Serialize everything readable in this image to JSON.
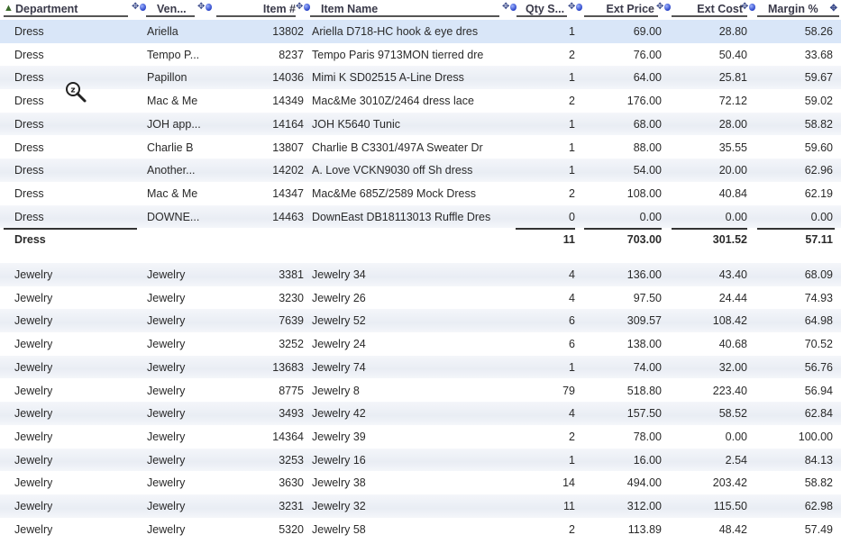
{
  "columns": {
    "department": "Department",
    "vendor": "Ven...",
    "item_no": "Item #",
    "item_name": "Item Name",
    "qty": "Qty S...",
    "ext_price": "Ext Price",
    "ext_cost": "Ext Cost",
    "margin": "Margin %"
  },
  "dress_rows": [
    {
      "dept": "Dress",
      "vendor": "Ariella",
      "item": "13802",
      "name": "Ariella D718-HC hook & eye dres",
      "qty": "1",
      "price": "69.00",
      "cost": "28.80",
      "margin": "58.26"
    },
    {
      "dept": "Dress",
      "vendor": "Tempo P...",
      "item": "8237",
      "name": "Tempo Paris 9713MON tierred dre",
      "qty": "2",
      "price": "76.00",
      "cost": "50.40",
      "margin": "33.68"
    },
    {
      "dept": "Dress",
      "vendor": "Papillon",
      "item": "14036",
      "name": "Mimi K SD02515 A-Line Dress",
      "qty": "1",
      "price": "64.00",
      "cost": "25.81",
      "margin": "59.67"
    },
    {
      "dept": "Dress",
      "vendor": "Mac & Me",
      "item": "14349",
      "name": "Mac&Me 3010Z/2464 dress lace",
      "qty": "2",
      "price": "176.00",
      "cost": "72.12",
      "margin": "59.02"
    },
    {
      "dept": "Dress",
      "vendor": "JOH app...",
      "item": "14164",
      "name": "JOH K5640 Tunic",
      "qty": "1",
      "price": "68.00",
      "cost": "28.00",
      "margin": "58.82"
    },
    {
      "dept": "Dress",
      "vendor": "Charlie B",
      "item": "13807",
      "name": "Charlie B C3301/497A Sweater Dr",
      "qty": "1",
      "price": "88.00",
      "cost": "35.55",
      "margin": "59.60"
    },
    {
      "dept": "Dress",
      "vendor": "Another...",
      "item": "14202",
      "name": "A. Love VCKN9030 off Sh dress",
      "qty": "1",
      "price": "54.00",
      "cost": "20.00",
      "margin": "62.96"
    },
    {
      "dept": "Dress",
      "vendor": "Mac & Me",
      "item": "14347",
      "name": "Mac&Me 685Z/2589 Mock Dress",
      "qty": "2",
      "price": "108.00",
      "cost": "40.84",
      "margin": "62.19"
    },
    {
      "dept": "Dress",
      "vendor": "DOWNE...",
      "item": "14463",
      "name": "DownEast DB18113013 Ruffle Dres",
      "qty": "0",
      "price": "0.00",
      "cost": "0.00",
      "margin": "0.00"
    }
  ],
  "dress_total": {
    "dept": "Dress",
    "qty": "11",
    "price": "703.00",
    "cost": "301.52",
    "margin": "57.11"
  },
  "jewelry_rows": [
    {
      "dept": "Jewelry",
      "vendor": "Jewelry",
      "item": "3381",
      "name": "Jewelry 34",
      "qty": "4",
      "price": "136.00",
      "cost": "43.40",
      "margin": "68.09"
    },
    {
      "dept": "Jewelry",
      "vendor": "Jewelry",
      "item": "3230",
      "name": "Jewelry 26",
      "qty": "4",
      "price": "97.50",
      "cost": "24.44",
      "margin": "74.93"
    },
    {
      "dept": "Jewelry",
      "vendor": "Jewelry",
      "item": "7639",
      "name": "Jewelry 52",
      "qty": "6",
      "price": "309.57",
      "cost": "108.42",
      "margin": "64.98"
    },
    {
      "dept": "Jewelry",
      "vendor": "Jewelry",
      "item": "3252",
      "name": "Jewelry 24",
      "qty": "6",
      "price": "138.00",
      "cost": "40.68",
      "margin": "70.52"
    },
    {
      "dept": "Jewelry",
      "vendor": "Jewelry",
      "item": "13683",
      "name": "Jewelry 74",
      "qty": "1",
      "price": "74.00",
      "cost": "32.00",
      "margin": "56.76"
    },
    {
      "dept": "Jewelry",
      "vendor": "Jewelry",
      "item": "8775",
      "name": "Jewelry 8",
      "qty": "79",
      "price": "518.80",
      "cost": "223.40",
      "margin": "56.94"
    },
    {
      "dept": "Jewelry",
      "vendor": "Jewelry",
      "item": "3493",
      "name": "Jewelry 42",
      "qty": "4",
      "price": "157.50",
      "cost": "58.52",
      "margin": "62.84"
    },
    {
      "dept": "Jewelry",
      "vendor": "Jewelry",
      "item": "14364",
      "name": "Jewelry 39",
      "qty": "2",
      "price": "78.00",
      "cost": "0.00",
      "margin": "100.00"
    },
    {
      "dept": "Jewelry",
      "vendor": "Jewelry",
      "item": "3253",
      "name": "Jewelry 16",
      "qty": "1",
      "price": "16.00",
      "cost": "2.54",
      "margin": "84.13"
    },
    {
      "dept": "Jewelry",
      "vendor": "Jewelry",
      "item": "3630",
      "name": "Jewelry 38",
      "qty": "14",
      "price": "494.00",
      "cost": "203.42",
      "margin": "58.82"
    },
    {
      "dept": "Jewelry",
      "vendor": "Jewelry",
      "item": "3231",
      "name": "Jewelry 32",
      "qty": "11",
      "price": "312.00",
      "cost": "115.50",
      "margin": "62.98"
    },
    {
      "dept": "Jewelry",
      "vendor": "Jewelry",
      "item": "5320",
      "name": "Jewelry 58",
      "qty": "2",
      "price": "113.89",
      "cost": "48.42",
      "margin": "57.49"
    }
  ],
  "icons": {
    "sort": "sort-ascending-icon",
    "move": "move-column-icon",
    "toggle": "column-toggle-icon",
    "cursor": "zoom-cursor-icon"
  },
  "colors": {
    "selected_row": "#d9e6f8",
    "alt_row": "#eef1f6",
    "header_text": "#3a3a4a",
    "icon_blue": "#2a44c8",
    "sort_green": "#3b6a2a"
  }
}
